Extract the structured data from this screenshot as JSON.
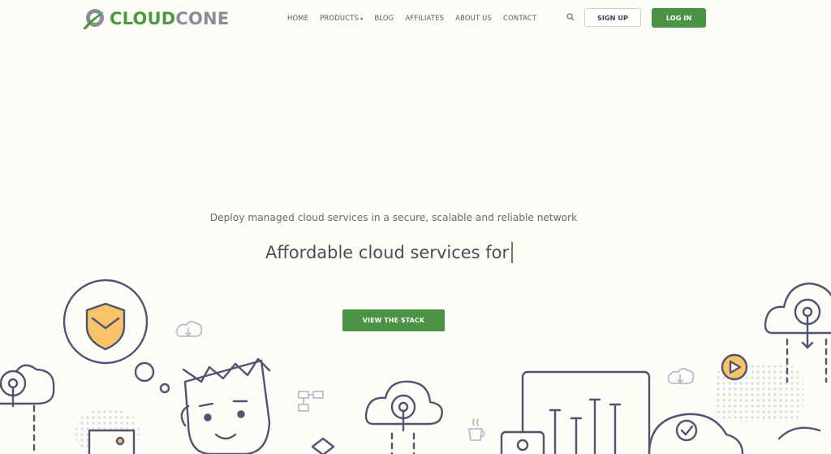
{
  "brand": {
    "name_part1": "CLOUD",
    "name_part2": "CONE",
    "primary_color": "#4b9344",
    "secondary_color": "#8a8d96"
  },
  "nav": {
    "items": [
      {
        "label": "HOME"
      },
      {
        "label": "PRODUCTS",
        "has_dropdown": true
      },
      {
        "label": "BLOG"
      },
      {
        "label": "AFFILIATES"
      },
      {
        "label": "ABOUT US"
      },
      {
        "label": "CONTACT"
      }
    ],
    "search_icon": "search-icon",
    "signup_label": "SIGN UP",
    "login_label": "LOG IN"
  },
  "hero": {
    "tagline": "Deploy managed cloud services in a secure, scalable and reliable network",
    "headline": "Affordable cloud services for",
    "cta_label": "VIEW THE STACK"
  },
  "colors": {
    "background": "#fefcf6",
    "illustration_stroke": "#4f5470",
    "illustration_accent": "#f9c36a"
  }
}
